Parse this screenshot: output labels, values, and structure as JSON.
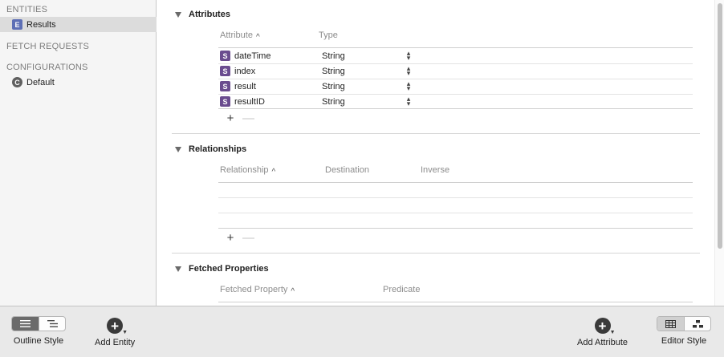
{
  "sidebar": {
    "entities_header": "ENTITIES",
    "entities": [
      {
        "badge": "E",
        "label": "Results"
      }
    ],
    "fetch_requests_header": "FETCH REQUESTS",
    "configurations_header": "CONFIGURATIONS",
    "configurations": [
      {
        "badge": "C",
        "label": "Default"
      }
    ]
  },
  "attributes": {
    "title": "Attributes",
    "col_attribute": "Attribute",
    "col_type": "Type",
    "rows": [
      {
        "badge": "S",
        "name": "dateTime",
        "type": "String"
      },
      {
        "badge": "S",
        "name": "index",
        "type": "String"
      },
      {
        "badge": "S",
        "name": "result",
        "type": "String"
      },
      {
        "badge": "S",
        "name": "resultID",
        "type": "String"
      }
    ]
  },
  "relationships": {
    "title": "Relationships",
    "col_relationship": "Relationship",
    "col_destination": "Destination",
    "col_inverse": "Inverse"
  },
  "fetched_properties": {
    "title": "Fetched Properties",
    "col_fetched_property": "Fetched Property",
    "col_predicate": "Predicate"
  },
  "controls": {
    "plus": "+",
    "minus": "—",
    "sort_caret": "^"
  },
  "toolbar": {
    "outline_style": "Outline Style",
    "add_entity": "Add Entity",
    "add_attribute": "Add Attribute",
    "editor_style": "Editor Style"
  }
}
